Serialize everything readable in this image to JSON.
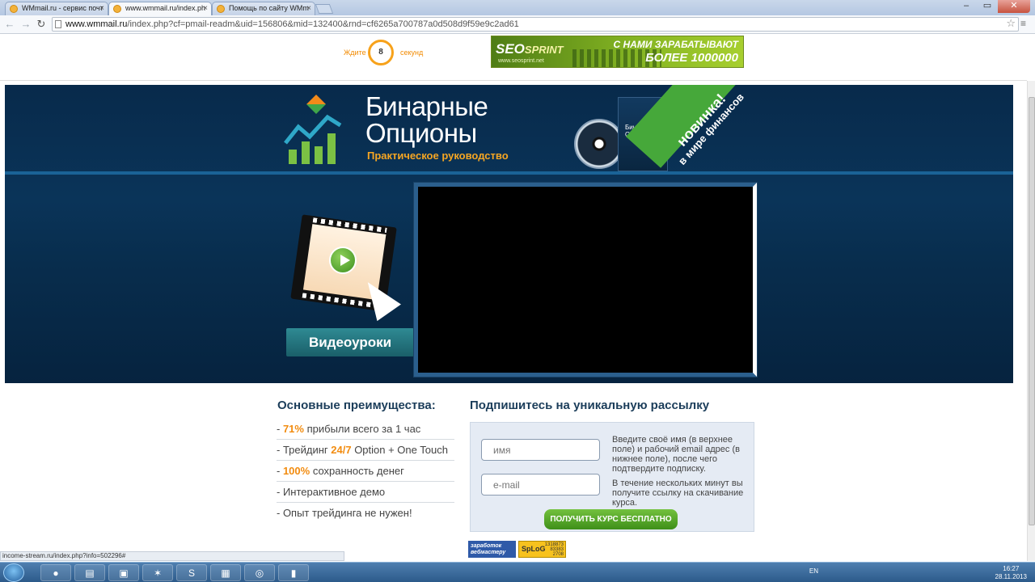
{
  "browser": {
    "tabs": [
      {
        "label": "WMmail.ru - сервис почт",
        "active": false
      },
      {
        "label": "www.wmmail.ru/index.ph",
        "active": true
      },
      {
        "label": "Помощь по сайту WMm",
        "active": false
      }
    ],
    "url_host": "www.wmmail.ru",
    "url_path": "/index.php?cf=pmail-readm&uid=156806&mid=132400&rnd=cf6265a700787a0d508d9f59e9c2ad61"
  },
  "adbar": {
    "timer_left": "Ждите",
    "timer_value": "8",
    "timer_right": "секунд",
    "banner": {
      "logo_a": "SEO",
      "logo_b": "SPRINT",
      "url": "www.seosprint.net",
      "line1": "С НАМИ ЗАРАБАТЫВАЮТ",
      "line2": "БОЛЕЕ 1000000"
    }
  },
  "hero": {
    "title_line1": "Бинарные",
    "title_line2": "Опционы",
    "subtitle": "Практическое руководство",
    "book_title": "Бинарные Опционы",
    "ribbon_line1": "новинка!",
    "ribbon_line2": "в мире финансов",
    "video_button": "Видеоуроки"
  },
  "advantages": {
    "title": "Основные преимущества:",
    "items": [
      {
        "prefix": "- ",
        "highlight": "71%",
        "text": " прибыли всего за 1 час"
      },
      {
        "prefix": "- Трейдинг ",
        "highlight": "24/7",
        "text": " Option + One Touch"
      },
      {
        "prefix": "- ",
        "highlight": "100%",
        "text": " сохранность денег"
      },
      {
        "prefix": "- Интерактивное демо",
        "highlight": "",
        "text": ""
      },
      {
        "prefix": "- Опыт трейдинга не нужен!",
        "highlight": "",
        "text": ""
      }
    ]
  },
  "subscribe": {
    "title": "Подпишитесь на уникальную рассылку",
    "name_placeholder": "имя",
    "email_placeholder": "e-mail",
    "hint1": "Введите своё имя (в верхнее поле) и рабочий email адрес (в нижнее поле), после чего подтвердите подписку.",
    "hint2": "В течение нескольких минут вы получите ссылку на скачивание курса.",
    "button": "ПОЛУЧИТЬ КУРС БЕСПЛАТНО"
  },
  "counters": {
    "c1": "заработок вебмастеру",
    "c2_logo": "SpLoG",
    "c2_nums": [
      "1318873",
      "83383",
      "2708"
    ]
  },
  "status_url": "income-stream.ru/index.php?info=502296#",
  "taskbar": {
    "lang": "EN",
    "time": "16:27",
    "date": "28.11.2013"
  }
}
